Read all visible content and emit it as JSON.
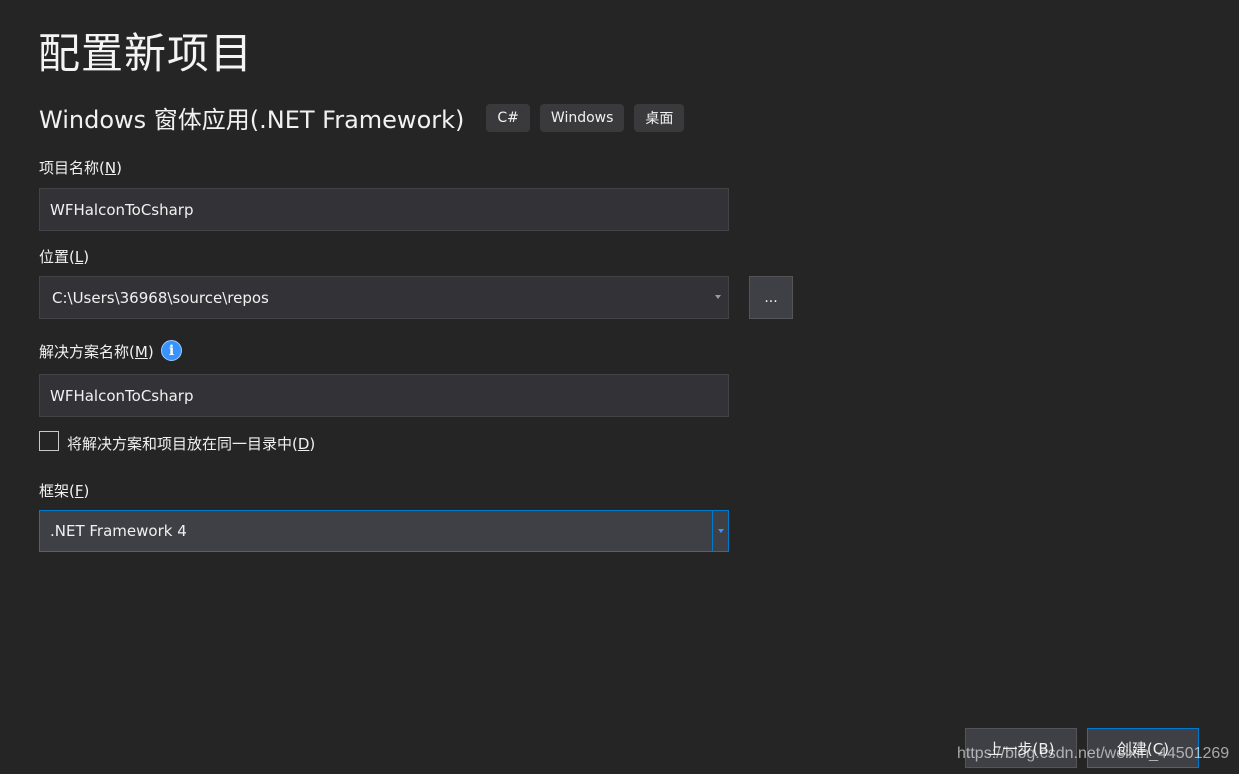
{
  "header": {
    "title": "配置新项目",
    "template_name": "Windows 窗体应用(.NET Framework)",
    "tags": [
      "C#",
      "Windows",
      "桌面"
    ]
  },
  "project_name": {
    "label": "项目名称(",
    "mnemonic": "N",
    "label_end": ")",
    "value": "WFHalconToCsharp"
  },
  "location": {
    "label": "位置(",
    "mnemonic": "L",
    "label_end": ")",
    "value": "C:\\Users\\36968\\source\\repos",
    "browse_label": "..."
  },
  "solution_name": {
    "label": "解决方案名称(",
    "mnemonic": "M",
    "label_end": ")",
    "value": "WFHalconToCsharp",
    "info_icon": "info-icon"
  },
  "same_directory": {
    "label": "将解决方案和项目放在同一目录中(",
    "mnemonic": "D",
    "label_end": ")",
    "checked": false
  },
  "framework": {
    "label": "框架(",
    "mnemonic": "F",
    "label_end": ")",
    "value": ".NET Framework 4"
  },
  "footer": {
    "back_label": "上一步(B)",
    "create_label": "创建(C)"
  },
  "watermark": "https://blog.csdn.net/weixin_44501269",
  "colors": {
    "background": "#252526",
    "input_background": "#333337",
    "accent": "#007acc",
    "info": "#3794ff"
  }
}
